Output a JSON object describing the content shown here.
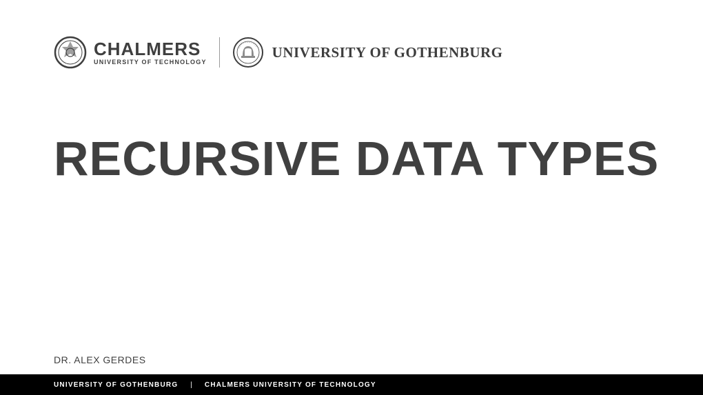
{
  "header": {
    "chalmers": {
      "name": "CHALMERS",
      "subtitle": "UNIVERSITY OF TECHNOLOGY"
    },
    "gothenburg": {
      "name": "UNIVERSITY OF GOTHENBURG"
    }
  },
  "title": "RECURSIVE DATA TYPES",
  "author": "DR. ALEX GERDES",
  "footer": {
    "left": "UNIVERSITY OF GOTHENBURG",
    "separator": "|",
    "right": "CHALMERS UNIVERSITY OF TECHNOLOGY"
  }
}
